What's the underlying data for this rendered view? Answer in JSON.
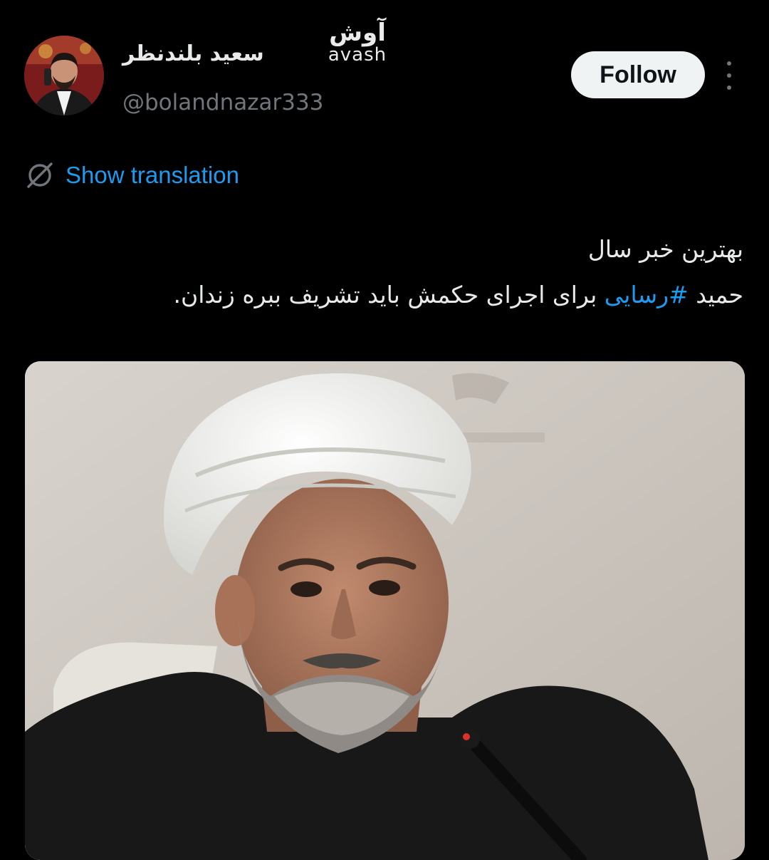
{
  "tweet": {
    "author": {
      "display_name": "سعید بلندنظر",
      "handle": "@bolandnazar333",
      "avatar_icon": "profile-photo"
    },
    "follow_label": "Follow",
    "more_icon": "more-vertical-icon",
    "translation": {
      "icon": "globe-icon",
      "label": "Show translation"
    },
    "text": {
      "line1": "بهترین خبر سال",
      "line2_before": "حمید ",
      "hashtag": "#رسایی",
      "line2_after": " برای اجرای حکمش باید تشریف ببره زندان."
    },
    "media": {
      "type": "photo"
    }
  },
  "watermark": {
    "fa": "آوش",
    "en": "avash"
  },
  "colors": {
    "background": "#000000",
    "text": "#e7e9ea",
    "secondary_text": "#71767b",
    "link": "#1d9bf0",
    "follow_bg": "#eff3f4"
  }
}
